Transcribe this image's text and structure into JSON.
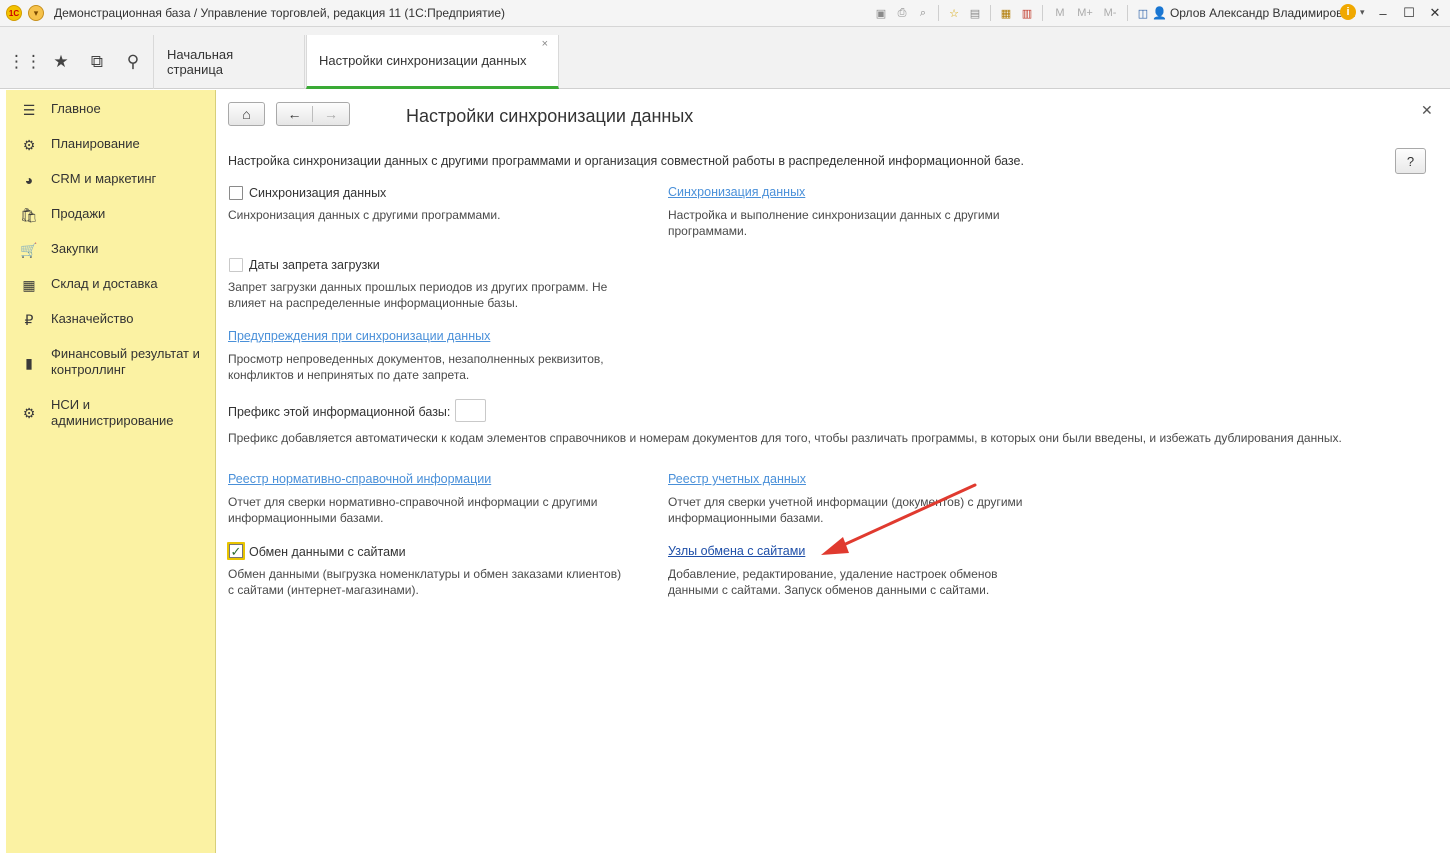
{
  "window": {
    "title": "Демонстрационная база / Управление торговлей, редакция 11  (1С:Предприятие)",
    "user": "Орлов Александр Владимирович",
    "logo_text": "1С",
    "memory_buttons": [
      "M",
      "M+",
      "M-"
    ]
  },
  "tabs": {
    "home": "Начальная страница",
    "active": "Настройки синхронизации данных"
  },
  "sidebar": {
    "items": [
      {
        "label": "Главное",
        "icon": "menu-lines-icon"
      },
      {
        "label": "Планирование",
        "icon": "planning-icon"
      },
      {
        "label": "CRM и маркетинг",
        "icon": "pie-chart-icon"
      },
      {
        "label": "Продажи",
        "icon": "shopping-bag-icon"
      },
      {
        "label": "Закупки",
        "icon": "cart-icon"
      },
      {
        "label": "Склад и доставка",
        "icon": "warehouse-grid-icon"
      },
      {
        "label": "Казначейство",
        "icon": "ruble-coin-icon"
      },
      {
        "label": "Финансовый результат и контроллинг",
        "icon": "bar-chart-icon"
      },
      {
        "label": "НСИ и администрирование",
        "icon": "gear-icon"
      }
    ]
  },
  "page": {
    "title": "Настройки синхронизации данных",
    "description": "Настройка синхронизации данных с другими программами и организация совместной работы в распределенной информационной базе.",
    "help_label": "?",
    "sync": {
      "checkbox_label": "Синхронизация данных",
      "checkbox_desc": "Синхронизация данных с другими программами.",
      "link": "Синхронизация данных",
      "link_desc": "Настройка и выполнение синхронизации данных с другими программами."
    },
    "prohibit": {
      "checkbox_label": "Даты запрета загрузки",
      "desc": "Запрет загрузки данных прошлых периодов из других программ. Не влияет на распределенные информационные базы."
    },
    "warnings": {
      "link": "Предупреждения при синхронизации данных",
      "desc": "Просмотр непроведенных документов, незаполненных реквизитов, конфликтов и непринятых по дате запрета."
    },
    "prefix": {
      "label": "Префикс этой информационной базы:",
      "value": "",
      "desc": "Префикс добавляется автоматически к кодам элементов справочников и номерам документов для того, чтобы различать программы, в которых они были введены, и избежать дублирования данных."
    },
    "nsi_registry": {
      "link": "Реестр нормативно-справочной информации",
      "desc": "Отчет для сверки нормативно-справочной информации с другими информационными базами."
    },
    "accounting_registry": {
      "link": "Реестр учетных данных",
      "desc": "Отчет для сверки учетной информации (документов) с другими информационными базами."
    },
    "sites": {
      "checkbox_label": "Обмен данными с сайтами",
      "checked": true,
      "desc": "Обмен данными (выгрузка номенклатуры и обмен заказами клиентов) с сайтами (интернет-магазинами).",
      "link": "Узлы обмена с сайтами",
      "link_desc": "Добавление, редактирование, удаление настроек обменов данными с сайтами. Запуск обменов данными с сайтами."
    }
  },
  "colors": {
    "sidebar_bg": "#fbf2a3",
    "active_tab_underline": "#3aaa35",
    "link": "#4a90d9",
    "annotation_arrow": "#e03a2f"
  }
}
